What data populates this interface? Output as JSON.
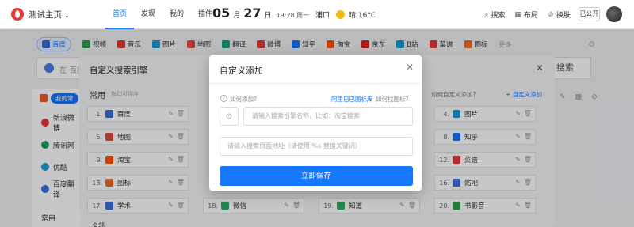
{
  "header": {
    "home_title": "测试主页",
    "nav": [
      "首页",
      "发现",
      "我的",
      "插件"
    ],
    "date": {
      "month": "05",
      "month_unit": "月",
      "day": "27",
      "day_unit": "日",
      "time": "19:28 周一"
    },
    "weather": {
      "city": "浦口",
      "desc": "晴 16°C"
    },
    "tools": [
      {
        "icon": "search-icon",
        "label": "搜索"
      },
      {
        "icon": "layout-icon",
        "label": "布局"
      },
      {
        "icon": "skin-icon",
        "label": "换肤"
      }
    ],
    "public_label": "已公开"
  },
  "engines": [
    "百度",
    "视频",
    "音乐",
    "图片",
    "地图",
    "翻译",
    "微博",
    "知乎",
    "淘宝",
    "京东",
    "B站",
    "菜谱",
    "图标"
  ],
  "engines_more": "更多",
  "engine_colors": [
    "#3b6fe0",
    "#2e9f4a",
    "#e0352b",
    "#1a9bd7",
    "#e64a3c",
    "#12a37f",
    "#e4393c",
    "#1677ff",
    "#ff5000",
    "#e1251b",
    "#00a1d6",
    "#e4393c",
    "#f06b28"
  ],
  "search": {
    "placeholder": "在 百度",
    "button": "搜索"
  },
  "left_list": [
    "新浪微博",
    "腾讯网",
    "优酷",
    "百度翻译"
  ],
  "left_tag": "我的常",
  "bottom": {
    "label": "常用",
    "all_label": "全部"
  },
  "panel": {
    "title": "自定义搜索引擎",
    "section": "常用",
    "section_sub": "拖动可排序",
    "help": "如何自定义添加?",
    "add": "+ 自定义添加",
    "cells": [
      {
        "num": "1.",
        "name": "百度",
        "color": "#3b6fe0"
      },
      {
        "num": "4.",
        "name": "图片",
        "color": "#1a9bd7"
      },
      {
        "num": "5.",
        "name": "地图",
        "color": "#e64a3c"
      },
      {
        "num": "8.",
        "name": "知乎",
        "color": "#1677ff"
      },
      {
        "num": "9.",
        "name": "淘宝",
        "color": "#ff5000"
      },
      {
        "num": "12.",
        "name": "菜谱",
        "color": "#e4393c"
      },
      {
        "num": "13.",
        "name": "图标",
        "color": "#f06b28"
      },
      {
        "num": "16.",
        "name": "贴吧",
        "color": "#3b6fe0"
      },
      {
        "num": "17.",
        "name": "学术",
        "color": "#3b6fe0"
      },
      {
        "num": "18.",
        "name": "微信",
        "color": "#2aae67"
      },
      {
        "num": "19.",
        "name": "知道",
        "color": "#2aae67"
      },
      {
        "num": "20.",
        "name": "书影音",
        "color": "#2e9f4a"
      }
    ]
  },
  "dialog": {
    "title": "自定义添加",
    "how_add": "如何添加?",
    "ali_link": "阿里巴巴图标库",
    "how_find": "如何找图标?",
    "name_placeholder": "请输入搜索引擎名称，比如：淘宝搜索",
    "url_placeholder": "请输入搜索页面地址（请使用 %s 替换关键词）",
    "save_label": "立即保存"
  }
}
